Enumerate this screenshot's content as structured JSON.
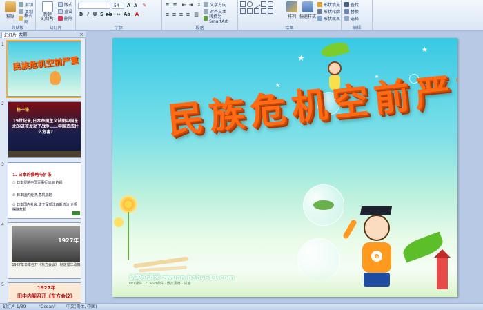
{
  "ribbon": {
    "groups": [
      {
        "label": "剪贴板"
      },
      {
        "label": "幻灯片"
      },
      {
        "label": "字体"
      },
      {
        "label": "段落"
      },
      {
        "label": "绘图"
      },
      {
        "label": "编辑"
      }
    ],
    "clipboard": {
      "paste": "粘贴",
      "cut": "剪切",
      "copy": "复制",
      "format_painter": "格式刷"
    },
    "slides": {
      "new_slide": "新建\n幻灯片",
      "layout": "版式",
      "reset": "重设",
      "delete": "删除"
    },
    "font": {
      "size": "54"
    },
    "paragraph": {
      "text_direction": "文字方向",
      "align_text": "对齐文本",
      "smartart": "转换为 SmartArt"
    },
    "drawing": {
      "arrange": "排列",
      "quick_styles": "快速样式",
      "fill": "形状填充",
      "outline": "形状轮廓",
      "effects": "形状效果"
    },
    "editing": {
      "find": "查找",
      "replace": "替换",
      "select": "选择"
    }
  },
  "left_pane": {
    "tabs": [
      "幻灯片",
      "大纲"
    ],
    "close": "×",
    "thumbnails": [
      {
        "num": "1",
        "title": "民族危机空前严重"
      },
      {
        "num": "2",
        "kicker": "秘一秘",
        "text": "19世纪末,日本帝国主义试图中国东北的进攻发动了战争……中国造成什么危害?"
      },
      {
        "num": "3",
        "heading": "1. 日本的侵略与扩张",
        "lines": [
          "① 日本侵略中国军事行动,目的是",
          "② 日本国内经济,危机加剧",
          "③ 日本国内社会,建立军部法西斯统治,企图摆脱危机"
        ]
      },
      {
        "num": "4",
        "year": "1927年",
        "caption": "1927年日本召开《东方会议》,制定侵华政策"
      },
      {
        "num": "5",
        "year": "1927年",
        "caption": "田中内阁召开《东方会议》"
      }
    ]
  },
  "slide": {
    "title": "民族危机空前严重",
    "watermark": "幼教资源网 ziyuan.baby611.com",
    "watermark_sub": "PPT课件 · FLASH课件 · 教案素材 · 试卷"
  },
  "status": {
    "slide_info": "幻灯片 1/39",
    "theme": "\"Ocean\"",
    "language": "中文(简体, 中国)"
  },
  "colors": {
    "ribbon_bg": "#dae6f5",
    "title_orange": "#ff6a12",
    "sky": "#37c9e4"
  }
}
